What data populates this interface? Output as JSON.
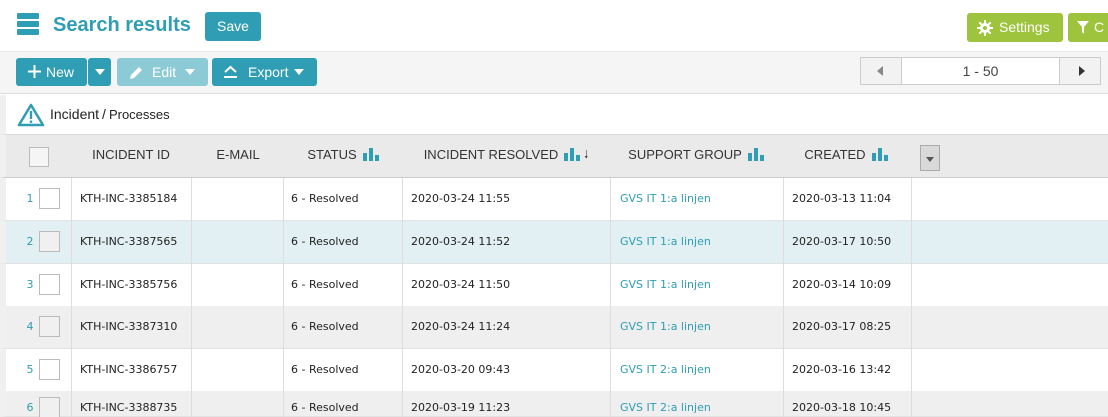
{
  "header": {
    "title": "Search results",
    "save_label": "Save",
    "settings_label": "Settings",
    "filter_label": "C"
  },
  "toolbar": {
    "new_label": "New",
    "edit_label": "Edit",
    "export_label": "Export"
  },
  "pager": {
    "range": "1 - 50"
  },
  "breadcrumb": {
    "root": "Incident",
    "separator": "/",
    "current": "Processes"
  },
  "table": {
    "columns": [
      "INCIDENT ID",
      "E-MAIL",
      "STATUS",
      "INCIDENT RESOLVED",
      "SUPPORT GROUP",
      "CREATED"
    ],
    "rows": [
      {
        "num": "1",
        "id": "KTH-INC-3385184",
        "email": "",
        "status": "6 - Resolved",
        "resolved": "2020-03-24 11:55",
        "group": "GVS IT 1:a linjen",
        "created": "2020-03-13 11:04"
      },
      {
        "num": "2",
        "id": "KTH-INC-3387565",
        "email": "",
        "status": "6 - Resolved",
        "resolved": "2020-03-24 11:52",
        "group": "GVS IT 1:a linjen",
        "created": "2020-03-17 10:50"
      },
      {
        "num": "3",
        "id": "KTH-INC-3385756",
        "email": "",
        "status": "6 - Resolved",
        "resolved": "2020-03-24 11:50",
        "group": "GVS IT 1:a linjen",
        "created": "2020-03-14 10:09"
      },
      {
        "num": "4",
        "id": "KTH-INC-3387310",
        "email": "",
        "status": "6 - Resolved",
        "resolved": "2020-03-24 11:24",
        "group": "GVS IT 1:a linjen",
        "created": "2020-03-17 08:25"
      },
      {
        "num": "5",
        "id": "KTH-INC-3386757",
        "email": "",
        "status": "6 - Resolved",
        "resolved": "2020-03-20 09:43",
        "group": "GVS IT 2:a linjen",
        "created": "2020-03-16 13:42"
      },
      {
        "num": "6",
        "id": "KTH-INC-3388735",
        "email": "",
        "status": "6 - Resolved",
        "resolved": "2020-03-19 11:23",
        "group": "GVS IT 2:a linjen",
        "created": "2020-03-18 10:45"
      }
    ]
  },
  "colors": {
    "accent": "#2f9db3",
    "settings": "#9dc43c",
    "edit_disabled": "#8ccad6",
    "selected_row": "#e2f0f4"
  },
  "icons": [
    "hamburger-menu-icon",
    "gear-icon",
    "funnel-icon",
    "plus-icon",
    "pencil-icon",
    "export-icon",
    "warning-triangle-icon",
    "bar-chart-icon",
    "sort-desc-icon"
  ]
}
